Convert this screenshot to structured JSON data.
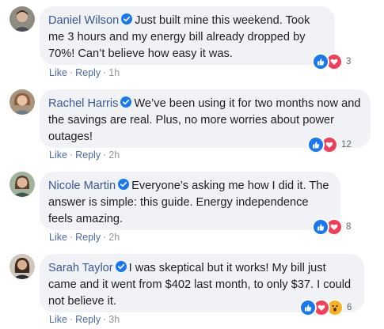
{
  "comments": [
    {
      "name": "Daniel Wilson",
      "text": "Just built mine this weekend. Took me 3 hours and my energy bill already dropped by 70%! Can’t believe how easy it was.",
      "like_label": "Like",
      "reply_label": "Reply",
      "time": "1h",
      "reaction_count": "3",
      "reactions": [
        "like-icon",
        "love-icon"
      ]
    },
    {
      "name": "Rachel Harris",
      "text": "We’ve been using it for two months now and the savings are real. Plus, no more worries about power outages!",
      "like_label": "Like",
      "reply_label": "Reply",
      "time": "2h",
      "reaction_count": "12",
      "reactions": [
        "like-icon",
        "love-icon"
      ]
    },
    {
      "name": "Nicole Martin",
      "text": "Everyone’s asking me how I did it. The answer is simple: this guide. Energy independence feels amazing.",
      "like_label": "Like",
      "reply_label": "Reply",
      "time": "2h",
      "reaction_count": "8",
      "reactions": [
        "like-icon",
        "love-icon"
      ]
    },
    {
      "name": "Sarah Taylor",
      "text": "I was skeptical but it works! My bill just came and it went from $402 last month, to only $37. I could not believe it.",
      "like_label": "Like",
      "reply_label": "Reply",
      "time": "3h",
      "reaction_count": "6",
      "reactions": [
        "like-icon",
        "love-icon",
        "wow-icon"
      ]
    }
  ],
  "separator": "·",
  "colors": {
    "name": "#385898",
    "bubble": "#f0f2f5",
    "verified": "#1877f2",
    "like": "#1877f2",
    "love": "#f33e58",
    "wow": "#f7b125"
  }
}
